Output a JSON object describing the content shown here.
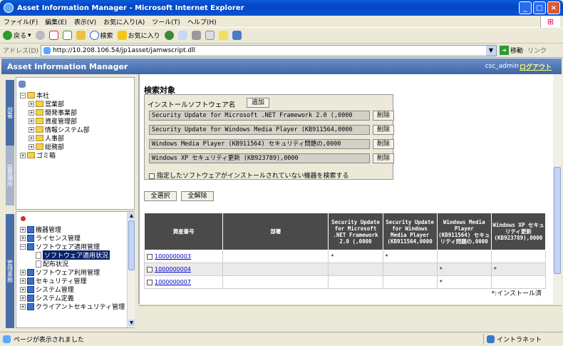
{
  "window": {
    "title": "Asset Information Manager - Microsoft Internet Explorer"
  },
  "menu": [
    "ファイル(F)",
    "編集(E)",
    "表示(V)",
    "お気に入り(A)",
    "ツール(T)",
    "ヘルプ(H)"
  ],
  "toolbar": {
    "back": "戻る",
    "search": "検索",
    "favorites": "お気に入り"
  },
  "address": {
    "label": "アドレス(D)",
    "url": "http://10.208.106.54/jp1asset/jamwscript.dll",
    "go": "移動",
    "links": "リンク"
  },
  "app": {
    "title": "Asset Information Manager",
    "user": "csc_admin",
    "logout": "ログアウト"
  },
  "left_tabs": {
    "dept": "部署",
    "place": "設置場所",
    "mgmt": "管理業務"
  },
  "dept_tree": [
    "本社",
    "営業部",
    "開発事業部",
    "資産管理部",
    "情報システム部",
    "人事部",
    "総務部",
    "ゴミ箱"
  ],
  "mgmt_tree": [
    "機器管理",
    "ライセンス管理",
    "ソフトウェア適用管理",
    "ソフトウェア適用状況",
    "配布状況",
    "ソフトウェア利用管理",
    "セキュリティ管理",
    "システム管理",
    "システム定義",
    "クライアントセキュリティ管理"
  ],
  "search": {
    "title": "検索対象",
    "label": "インストールソフトウェア名",
    "add": "追加",
    "delete": "削除",
    "items": [
      "Security Update for Microsoft .NET Framework 2.0 (,0000",
      "Security Update for Windows Media Player (KB911564,0000",
      "Windows Media Player (KB911564) セキュリティ問題の,0000",
      "Windows XP セキュリティ更新 (KB923789),0000"
    ],
    "option": "指定したソフトウェアがインストールされていない機器を検索する"
  },
  "buttons": {
    "select_all": "全選択",
    "clear_all": "全解除"
  },
  "table": {
    "headers": [
      "資産番号",
      "部署",
      "Security Update for Microsoft .NET Framework 2.0 (,0000",
      "Security Update for Windows Media Player (KB911564,0000",
      "Windows Media Player (KB911564) セキュリティ問題の,0000",
      "Windows XP セキュリティ更新 (KB923789),0000"
    ],
    "rows": [
      {
        "id": "1000000003",
        "c1": "*",
        "c2": "*",
        "c3": "",
        "c4": ""
      },
      {
        "id": "1000000004",
        "c1": "",
        "c2": "",
        "c3": "*",
        "c4": "*"
      },
      {
        "id": "1000000007",
        "c1": "",
        "c2": "",
        "c3": "*",
        "c4": ""
      }
    ],
    "legend": "*:インストール済"
  },
  "status": {
    "text": "ページが表示されました",
    "zone": "イントラネット"
  }
}
